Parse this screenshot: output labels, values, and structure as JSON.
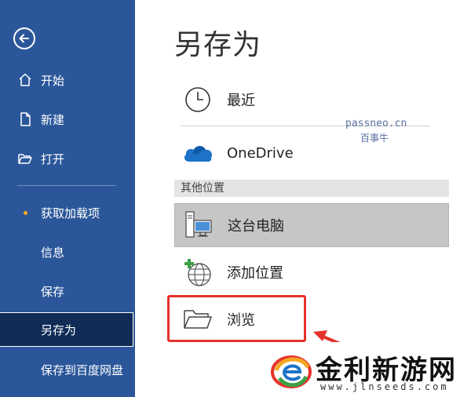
{
  "sidebar": {
    "items": [
      {
        "label": "开始",
        "icon": "home-icon"
      },
      {
        "label": "新建",
        "icon": "new-document-icon"
      },
      {
        "label": "打开",
        "icon": "folder-open-icon"
      },
      {
        "label": "获取加载项"
      },
      {
        "label": "信息"
      },
      {
        "label": "保存"
      },
      {
        "label": "另存为"
      },
      {
        "label": "保存到百度网盘"
      }
    ],
    "active_index": 6
  },
  "main": {
    "title": "另存为",
    "recent_label": "最近",
    "onedrive_label": "OneDrive",
    "section_header": "其他位置",
    "this_pc_label": "这台电脑",
    "add_place_label": "添加位置",
    "browse_label": "浏览"
  },
  "watermark": {
    "site": "passneo.cn",
    "name": "百事牛"
  },
  "brand": {
    "name": "金利新游网",
    "url": "www.jlnseeds.com"
  },
  "colors": {
    "sidebar_bg": "#2b579a",
    "active_bg": "#0f2b56",
    "highlight": "#e5322b",
    "onedrive_blue": "#1e73c8"
  }
}
